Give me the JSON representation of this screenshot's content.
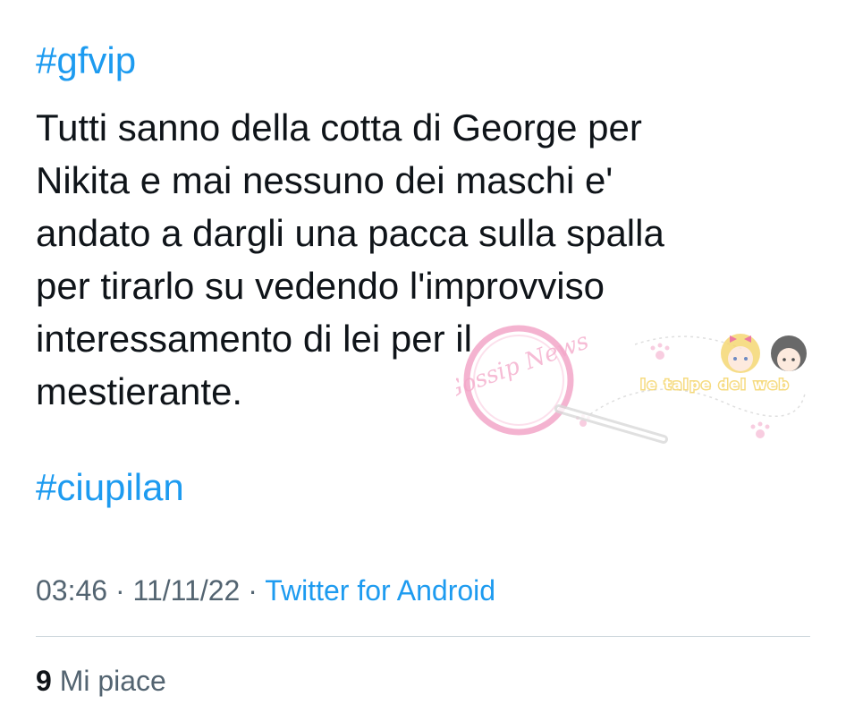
{
  "tweet": {
    "hashtag_top": "#gfvip",
    "body_lines": [
      "Tutti sanno della cotta di George per",
      "Nikita e mai nessuno dei maschi  e'",
      "andato a dargli una pacca sulla spalla",
      "per tirarlo su vedendo l'improvviso",
      "interessamento di lei per il",
      "mestierante."
    ],
    "hashtag_bottom": "#ciupilan",
    "time": "03:46",
    "separator": " · ",
    "date": "11/11/22",
    "source": "Twitter for Android",
    "likes_count": "9",
    "likes_label": "Mi piace"
  },
  "watermark": {
    "lens_text": "Gossip News",
    "banner_text": "le talpe del web"
  },
  "colors": {
    "link": "#1d9bf0",
    "text": "#0f1419",
    "muted": "#536471",
    "divider": "#cfd9de",
    "watermark_pink": "#f3a6c8",
    "watermark_yellow": "#f5d56b"
  }
}
